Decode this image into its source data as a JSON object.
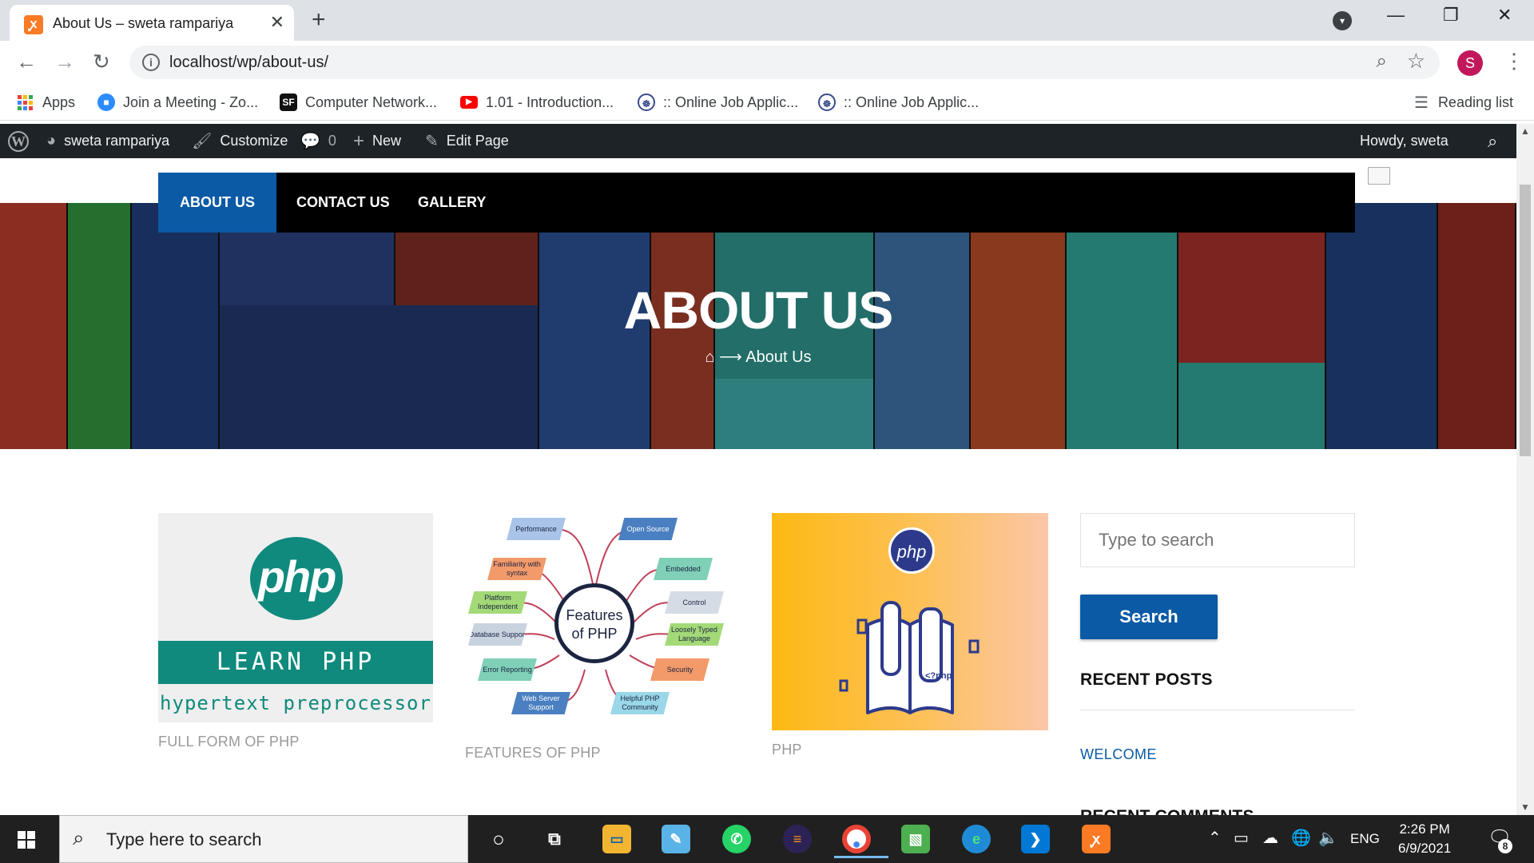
{
  "browser": {
    "tab_title": "About Us – sweta rampariya",
    "tab_favicon": "xampp-icon",
    "url": "localhost/wp/about-us/",
    "profile_initial": "S"
  },
  "bookmarks": {
    "items": [
      {
        "label": "Apps",
        "icon": "apps-grid-icon"
      },
      {
        "label": "Join a Meeting - Zo...",
        "icon": "zoom-icon",
        "color": "#2d8cff"
      },
      {
        "label": "Computer Network...",
        "icon": "sf-icon",
        "color": "#111111"
      },
      {
        "label": "1.01 - Introduction...",
        "icon": "youtube-icon",
        "color": "#ff0000"
      },
      {
        "label": ":: Online Job Applic...",
        "icon": "emblem-icon",
        "color": "#3a4a8c"
      },
      {
        "label": ":: Online Job Applic...",
        "icon": "emblem-icon",
        "color": "#3a4a8c"
      }
    ],
    "reading_list": "Reading list"
  },
  "admin_bar": {
    "site_name": "sweta rampariya",
    "customize": "Customize",
    "comments": "0",
    "new": "New",
    "edit_page": "Edit Page",
    "howdy": "Howdy, sweta"
  },
  "site": {
    "menu": [
      "ABOUT US",
      "CONTACT US",
      "GALLERY"
    ],
    "hero_title": "ABOUT US",
    "breadcrumb": "About Us",
    "accent_color": "#0b5aa6"
  },
  "posts": [
    {
      "caption": "FULL FORM OF PHP",
      "image_text": {
        "logo": "php",
        "band": "LEARN PHP",
        "sub": "hypertext preprocessor"
      }
    },
    {
      "caption": "FEATURES OF PHP",
      "image_text": {
        "center": "Features of PHP",
        "nodes": [
          "Performance",
          "Familiarity with syntax",
          "Platform Independent",
          "Database Support",
          "Error Reporting",
          "Web Server Support",
          "Open Source",
          "Embedded",
          "Control",
          "Loosely Typed Language",
          "Security",
          "Helpful PHP Community"
        ]
      }
    },
    {
      "caption": "PHP",
      "image_text": {
        "logo": "php",
        "book": "<?php"
      }
    }
  ],
  "sidebar": {
    "search_placeholder": "Type to search",
    "search_button": "Search",
    "recent_posts_title": "RECENT POSTS",
    "recent_posts": [
      "WELCOME"
    ],
    "next_widget_title": "RECENT COMMENTS"
  },
  "taskbar": {
    "search_placeholder": "Type here to search",
    "language": "ENG",
    "time": "2:26 PM",
    "date": "6/9/2021",
    "notification_count": "8"
  }
}
